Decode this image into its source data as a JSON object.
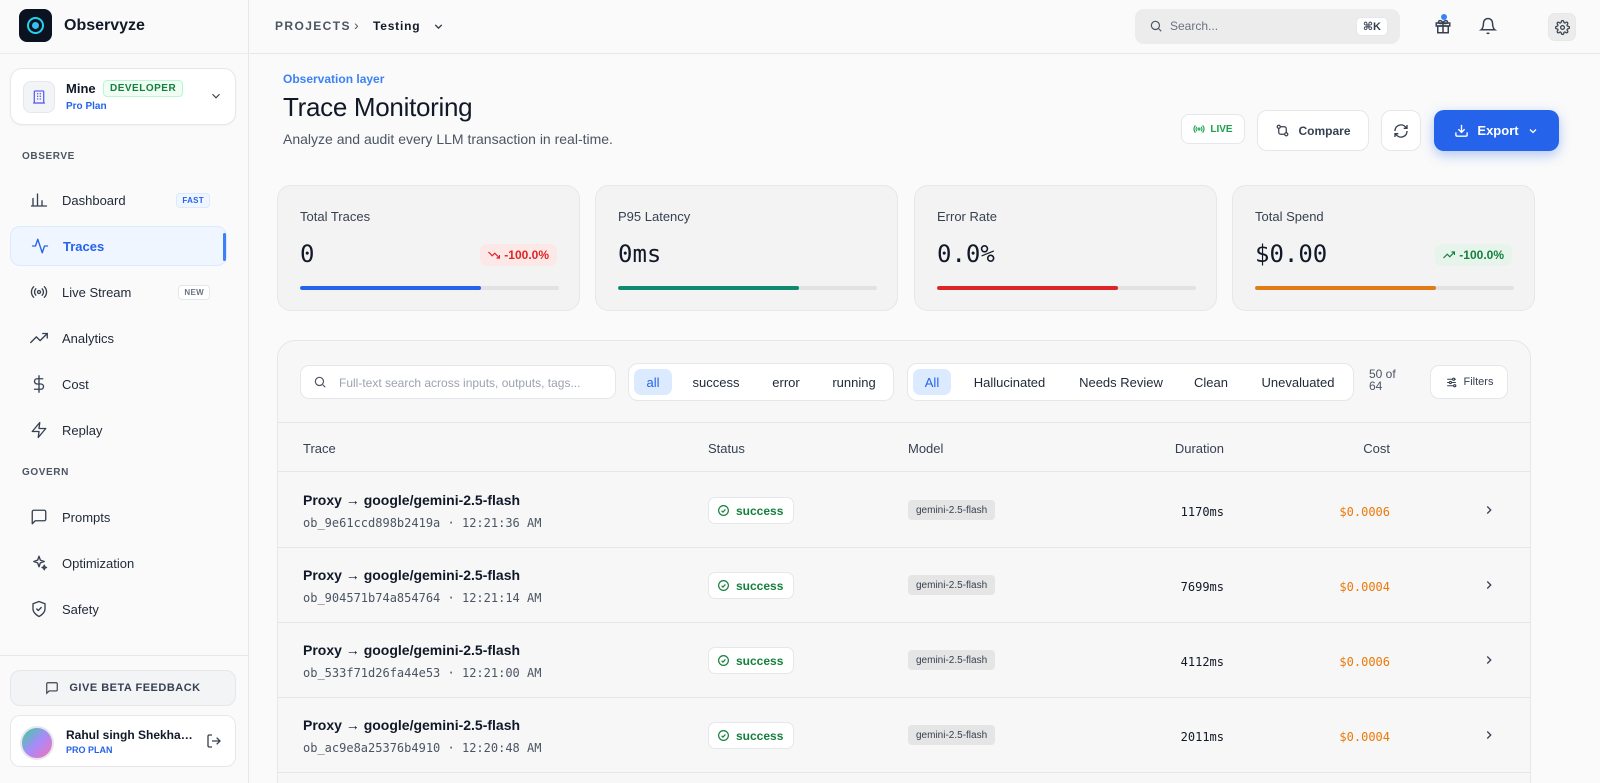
{
  "app": {
    "name": "Observyze"
  },
  "workspace": {
    "name": "Mine",
    "badge": "DEVELOPER",
    "plan": "Pro Plan"
  },
  "sidebar": {
    "sections": [
      {
        "label": "OBSERVE",
        "items": [
          {
            "label": "Dashboard",
            "icon": "bar-chart-icon",
            "tag": "FAST",
            "active": false
          },
          {
            "label": "Traces",
            "icon": "activity-icon",
            "tag": "",
            "active": true
          },
          {
            "label": "Live Stream",
            "icon": "broadcast-icon",
            "tag": "NEW",
            "active": false
          },
          {
            "label": "Analytics",
            "icon": "trending-up-icon",
            "tag": "",
            "active": false
          },
          {
            "label": "Cost",
            "icon": "dollar-icon",
            "tag": "",
            "active": false
          },
          {
            "label": "Replay",
            "icon": "zap-icon",
            "tag": "",
            "active": false
          }
        ]
      },
      {
        "label": "GOVERN",
        "items": [
          {
            "label": "Prompts",
            "icon": "message-square-icon",
            "tag": "",
            "active": false
          },
          {
            "label": "Optimization",
            "icon": "sparkles-icon",
            "tag": "",
            "active": false
          },
          {
            "label": "Safety",
            "icon": "shield-check-icon",
            "tag": "",
            "active": false
          }
        ]
      }
    ],
    "feedback_label": "GIVE BETA FEEDBACK",
    "user": {
      "name": "Rahul singh Shekhawat",
      "plan": "PRO PLAN"
    }
  },
  "header": {
    "breadcrumb_root": "PROJECTS",
    "breadcrumb_sep": "›",
    "breadcrumb_current": "Testing",
    "search_placeholder": "Search...",
    "search_shortcut": "⌘K"
  },
  "page": {
    "eyebrow": "Observation layer",
    "title": "Trace Monitoring",
    "subtitle": "Analyze and audit every LLM transaction in real-time.",
    "live_label": "LIVE",
    "compare_label": "Compare",
    "export_label": "Export"
  },
  "stats": [
    {
      "label": "Total Traces",
      "value": "0",
      "badge": "-100.0%",
      "trend": "down",
      "fill": 0.7,
      "color": "#2563eb"
    },
    {
      "label": "P95 Latency",
      "value": "0ms",
      "badge": "",
      "trend": "",
      "fill": 0.7,
      "color": "#0f8a6f"
    },
    {
      "label": "Error Rate",
      "value": "0.0%",
      "badge": "",
      "trend": "",
      "fill": 0.7,
      "color": "#dc2626"
    },
    {
      "label": "Total Spend",
      "value": "$0.00",
      "badge": "-100.0%",
      "trend": "up",
      "fill": 0.7,
      "color": "#e07b16"
    }
  ],
  "filters": {
    "search_placeholder": "Full-text search across inputs, outputs, tags...",
    "status_options": [
      "all",
      "success",
      "error",
      "running"
    ],
    "status_selected": "all",
    "eval_options": [
      "All",
      "Hallucinated",
      "Needs Review",
      "Clean",
      "Unevaluated"
    ],
    "eval_selected": "All",
    "result_count": "50 of 64",
    "filters_label": "Filters"
  },
  "table": {
    "columns": {
      "trace": "Trace",
      "status": "Status",
      "model": "Model",
      "duration": "Duration",
      "cost": "Cost"
    },
    "rows": [
      {
        "title": "Proxy → google/gemini-2.5-flash",
        "id": "ob_9e61ccd898b2419a",
        "time": "12:21:36 AM",
        "status": "success",
        "model": "gemini-2.5-flash",
        "duration": "1170ms",
        "cost": "$0.0006"
      },
      {
        "title": "Proxy → google/gemini-2.5-flash",
        "id": "ob_904571b74a854764",
        "time": "12:21:14 AM",
        "status": "success",
        "model": "gemini-2.5-flash",
        "duration": "7699ms",
        "cost": "$0.0004"
      },
      {
        "title": "Proxy → google/gemini-2.5-flash",
        "id": "ob_533f71d26fa44e53",
        "time": "12:21:00 AM",
        "status": "success",
        "model": "gemini-2.5-flash",
        "duration": "4112ms",
        "cost": "$0.0006"
      },
      {
        "title": "Proxy → google/gemini-2.5-flash",
        "id": "ob_ac9e8a25376b4910",
        "time": "12:20:48 AM",
        "status": "success",
        "model": "gemini-2.5-flash",
        "duration": "2011ms",
        "cost": "$0.0004"
      }
    ]
  }
}
